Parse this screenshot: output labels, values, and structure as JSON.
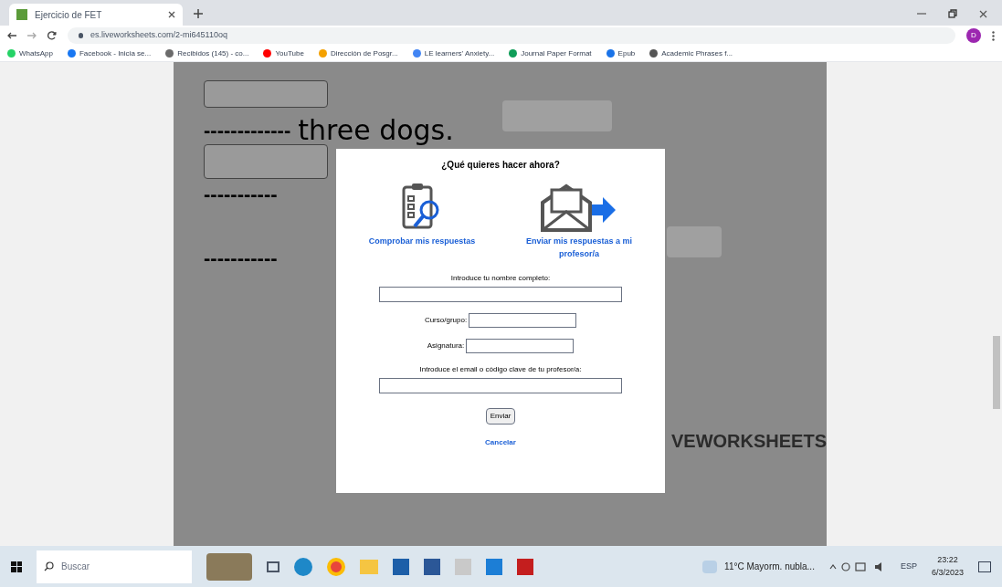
{
  "browser": {
    "tab": {
      "title": "Ejercicio de FET"
    },
    "address": "es.liveworksheets.com/2-mi645110oq",
    "avatar": "D",
    "bookmarks": [
      "WhatsApp",
      "Facebook - Inicia se...",
      "Recibidos (145) - co...",
      "YouTube",
      "Dirección de Posgr...",
      "LE learners' Anxiety...",
      "Journal Paper Format",
      "Epub",
      "Academic Phrases f..."
    ]
  },
  "worksheet": {
    "blanks": [
      "-------------",
      "-----------",
      "-----------"
    ],
    "sentence": "three dogs.",
    "brand": "VEWORKSHEETS"
  },
  "dialog": {
    "title": "¿Qué quieres hacer ahora?",
    "options": [
      {
        "kind": "check",
        "label": "Comprobar mis respuestas"
      },
      {
        "kind": "send",
        "label": "Enviar mis respuestas a mi profesor/a"
      }
    ],
    "fields": [
      {
        "kind": "stacked",
        "label": "Introduce tu nombre completo:"
      },
      {
        "kind": "inline",
        "label": "Curso/grupo:"
      },
      {
        "kind": "inline",
        "label": "Asignatura:"
      },
      {
        "kind": "stacked",
        "label": "Introduce el email o código clave de tu profesor/a:"
      }
    ],
    "submit": "Enviar",
    "cancel": "Cancelar"
  },
  "taskbar": {
    "search": {
      "placeholder": "Buscar"
    },
    "weather": "11°C Mayorm. nubla...",
    "language": "ESP",
    "time": "23:22",
    "date": "6/3/2023"
  }
}
